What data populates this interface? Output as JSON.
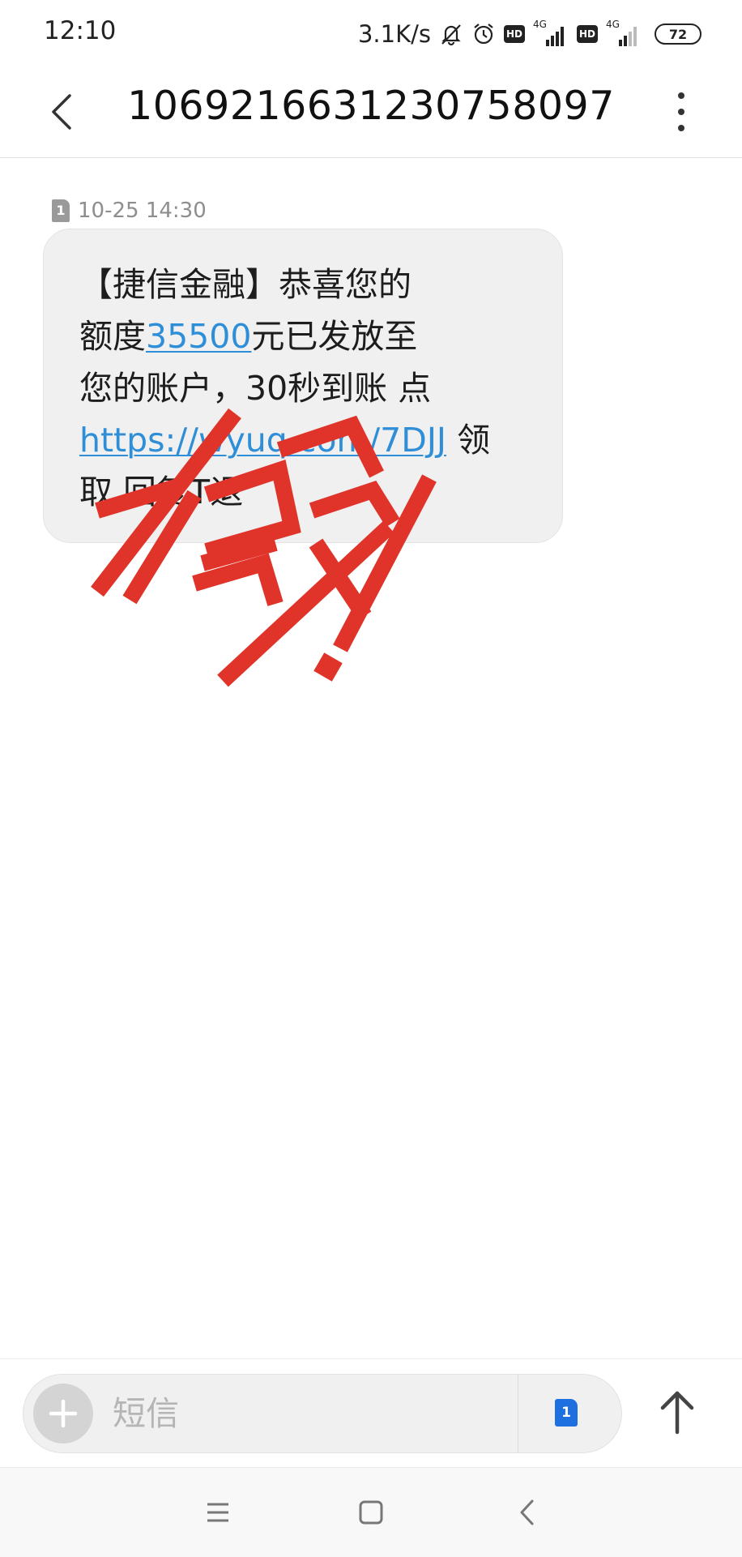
{
  "status_bar": {
    "time": "12:10",
    "net_speed": "3.1K/s",
    "hd_label": "HD",
    "net_type_1": "4G",
    "net_type_2": "4G",
    "battery": "72"
  },
  "title_bar": {
    "title": "1069216631230758097"
  },
  "message": {
    "sim_slot": "1",
    "timestamp": "10-25 14:30",
    "line1": "【捷信金融】恭喜您的",
    "line2_prefix": "额度",
    "line2_amount": "35500",
    "line2_suffix": "元已发放至",
    "line3": "您的账户，30秒到账 点",
    "line4_link": "https://wyuq.com/7DJJ",
    "line4_suffix": " 领",
    "line5": "取 回复T退"
  },
  "composer": {
    "placeholder": "短信",
    "sim_slot": "1"
  },
  "colors": {
    "link": "#2f8ed8",
    "stamp": "#e0342a",
    "sim_blue": "#1e6fe0"
  },
  "icons": {
    "back": "back-arrow-icon",
    "more": "more-vertical-icon",
    "add": "plus-icon",
    "send": "send-arrow-icon",
    "nav_menu": "menu-icon",
    "nav_home": "home-icon",
    "nav_back": "nav-back-icon"
  }
}
